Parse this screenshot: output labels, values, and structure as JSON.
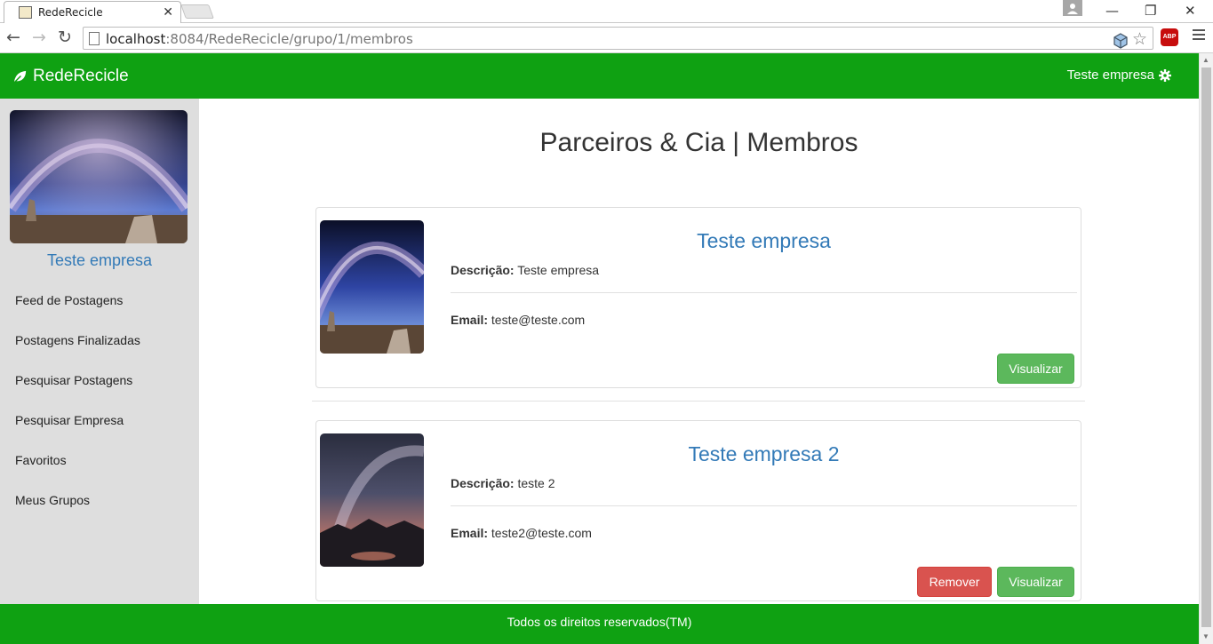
{
  "browser": {
    "tab_title": "RedeRecicle",
    "url_host": "localhost",
    "url_path": ":8084/RedeRecicle/grupo/1/membros",
    "adblock_label": "ABP"
  },
  "navbar": {
    "brand": "RedeRecicle",
    "user": "Teste empresa",
    "color": "#0fa112"
  },
  "sidebar": {
    "profile_name": "Teste empresa",
    "items": [
      {
        "label": "Feed de Postagens"
      },
      {
        "label": "Postagens Finalizadas"
      },
      {
        "label": "Pesquisar Postagens"
      },
      {
        "label": "Pesquisar Empresa"
      },
      {
        "label": "Favoritos"
      },
      {
        "label": "Meus Grupos"
      }
    ]
  },
  "main": {
    "title": "Parceiros & Cia | Membros",
    "members": [
      {
        "name": "Teste empresa",
        "desc_label": "Descrição:",
        "desc_value": "Teste empresa",
        "email_label": "Email:",
        "email_value": "teste@teste.com",
        "view_label": "Visualizar"
      },
      {
        "name": "Teste empresa 2",
        "desc_label": "Descrição:",
        "desc_value": "teste 2",
        "email_label": "Email:",
        "email_value": "teste2@teste.com",
        "remove_label": "Remover",
        "view_label": "Visualizar"
      }
    ]
  },
  "footer": {
    "text": "Todos os direitos reservados(TM)"
  }
}
